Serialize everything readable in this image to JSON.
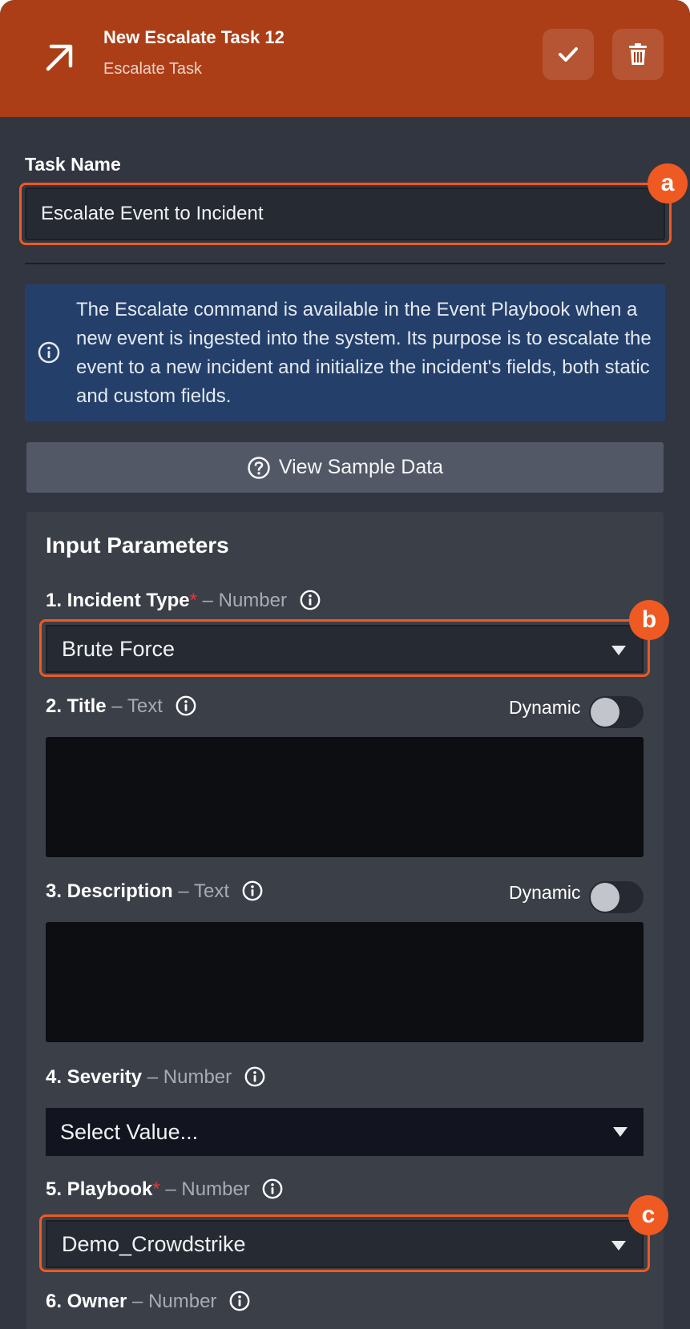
{
  "header": {
    "title": "New Escalate Task 12",
    "subtitle": "Escalate Task",
    "icon": "arrow-up-right-icon",
    "save_icon": "check-icon",
    "delete_icon": "trash-icon"
  },
  "task_name": {
    "label": "Task Name",
    "value": "Escalate Event to Incident"
  },
  "info": {
    "icon": "info-circle-icon",
    "text": "The Escalate command is available in the Event Playbook when a new event is ingested into the system. Its purpose is to escalate the event to a new incident and initialize the incident's fields, both static and custom fields."
  },
  "sample_button": {
    "icon": "question-circle-icon",
    "label": "View Sample Data"
  },
  "params": {
    "title": "Input Parameters",
    "dynamic_label": "Dynamic",
    "fields": [
      {
        "name": "1. Incident Type",
        "required": "*",
        "type": "– Number",
        "value": "Brute Force"
      },
      {
        "name": "2. Title",
        "type": "– Text",
        "value": ""
      },
      {
        "name": "3. Description",
        "type": "– Text",
        "value": ""
      },
      {
        "name": "4. Severity",
        "type": "– Number",
        "value": "Select Value..."
      },
      {
        "name": "5. Playbook",
        "required": "*",
        "type": "– Number",
        "value": "Demo_Crowdstrike"
      },
      {
        "name": "6. Owner",
        "type": "– Number"
      }
    ]
  },
  "callouts": [
    "a",
    "b",
    "c"
  ],
  "colors": {
    "header": "#ac3e17",
    "accent": "#ee5a22",
    "panel": "#323640",
    "info_bg": "#24406a",
    "required": "#e2373a"
  }
}
